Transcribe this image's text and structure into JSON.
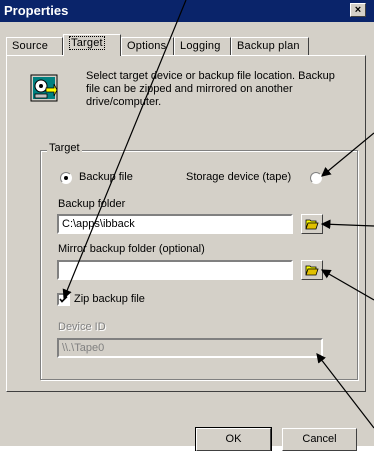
{
  "window": {
    "title": "Properties",
    "close_glyph": "×"
  },
  "tabs": [
    {
      "label": "Source",
      "active": false
    },
    {
      "label": "Target",
      "active": true
    },
    {
      "label": "Options",
      "active": false
    },
    {
      "label": "Logging",
      "active": false
    },
    {
      "label": "Backup plan",
      "active": false
    }
  ],
  "intro": {
    "text": "Select target device or backup file location. Backup file can be zipped and mirrored on another drive/computer.",
    "icon": "backup-target-icon"
  },
  "target_group": {
    "legend": "Target",
    "radio_backup_file": {
      "label": "Backup file",
      "selected": true
    },
    "radio_storage_device": {
      "label": "Storage device (tape)",
      "selected": false
    },
    "backup_folder": {
      "label": "Backup folder",
      "value": "C:\\apps\\ibback"
    },
    "mirror_folder": {
      "label": "Mirror backup folder (optional)",
      "value": ""
    },
    "zip_checkbox": {
      "label": "Zip backup file",
      "checked": true
    },
    "device_id": {
      "label": "Device ID",
      "value": "\\\\.\\Tape0",
      "disabled": true
    }
  },
  "buttons": {
    "ok_label": "OK",
    "cancel_label": "Cancel"
  },
  "colors": {
    "titlebar": "#0a246a",
    "face": "#d4d0c8",
    "folder_icon": "#ffff00"
  }
}
